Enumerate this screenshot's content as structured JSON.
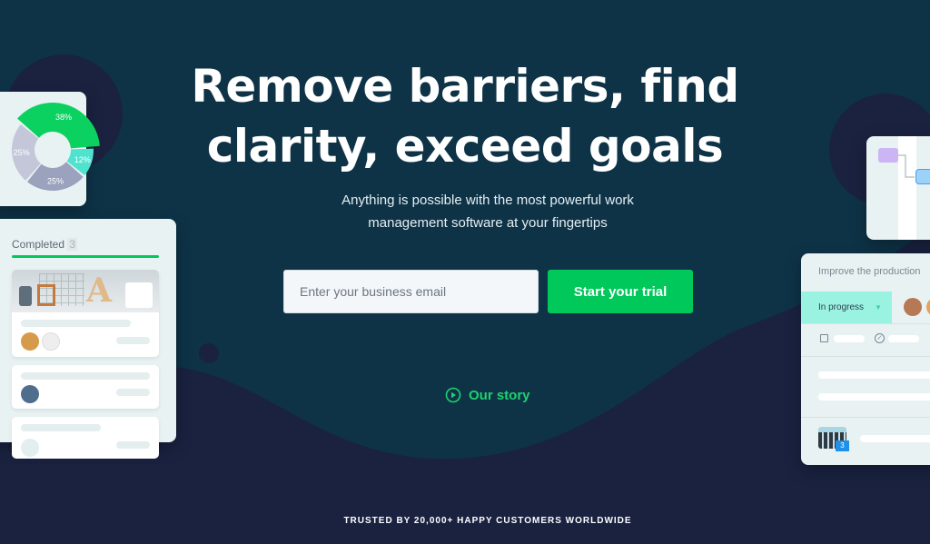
{
  "hero": {
    "title": "Remove barriers, find clarity, exceed goals",
    "subtitle_line1": "Anything is possible with the most powerful work",
    "subtitle_line2": "management software at your fingertips"
  },
  "signup": {
    "email_placeholder": "Enter your business email",
    "email_value": "",
    "cta_label": "Start your trial"
  },
  "story": {
    "label": "Our story",
    "icon": "play-circle-icon"
  },
  "trusted": "TRUSTED BY 20,000+ HAPPY CUSTOMERS WORLDWIDE",
  "donut": {
    "segments": [
      {
        "label": "38%",
        "value": 38,
        "color": "#0bd160"
      },
      {
        "label": "12%",
        "value": 12,
        "color": "#4fe3cf"
      },
      {
        "label": "25%",
        "value": 25,
        "color": "#9aa2bd"
      },
      {
        "label": "25%",
        "value": 25,
        "color": "#c3c7d9"
      }
    ]
  },
  "board": {
    "column": "Completed",
    "count": "3"
  },
  "task": {
    "title": "Improve the production",
    "status": "In progress",
    "comments": "3"
  },
  "colors": {
    "accent": "#00c85a",
    "bg_top": "#0e3347",
    "bg_bottom": "#1a2240"
  }
}
